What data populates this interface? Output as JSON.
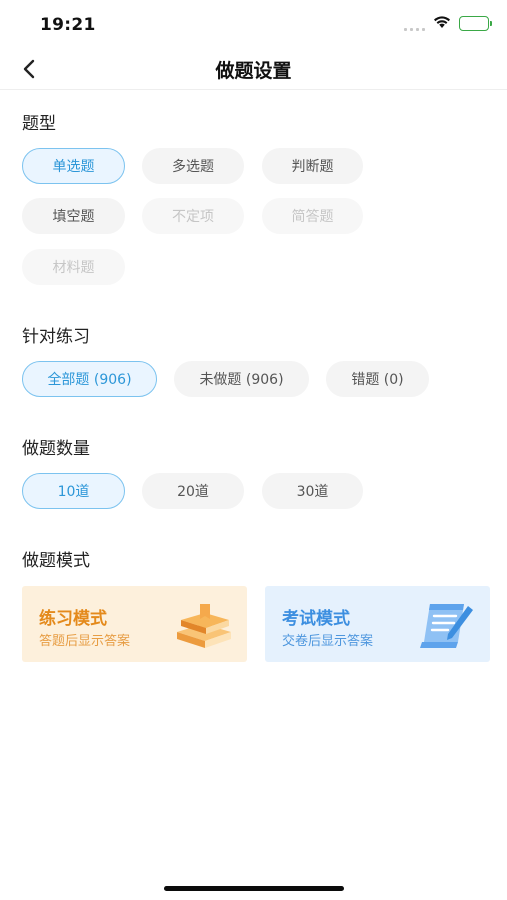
{
  "status_bar": {
    "time": "19:21"
  },
  "nav": {
    "title": "做题设置"
  },
  "question_type": {
    "title": "题型",
    "options": [
      {
        "label": "单选题",
        "state": "selected"
      },
      {
        "label": "多选题",
        "state": "normal"
      },
      {
        "label": "判断题",
        "state": "normal"
      },
      {
        "label": "填空题",
        "state": "normal"
      },
      {
        "label": "不定项",
        "state": "disabled"
      },
      {
        "label": "简答题",
        "state": "disabled"
      },
      {
        "label": "材料题",
        "state": "disabled"
      }
    ]
  },
  "target_practice": {
    "title": "针对练习",
    "options": [
      {
        "label": "全部题 (906)",
        "state": "selected"
      },
      {
        "label": "未做题 (906)",
        "state": "normal"
      },
      {
        "label": "错题 (0)",
        "state": "normal"
      }
    ]
  },
  "question_count": {
    "title": "做题数量",
    "options": [
      {
        "label": "10道",
        "state": "selected"
      },
      {
        "label": "20道",
        "state": "normal"
      },
      {
        "label": "30道",
        "state": "normal"
      }
    ]
  },
  "practice_mode": {
    "title": "做题模式",
    "cards": [
      {
        "title": "练习模式",
        "desc": "答题后显示答案",
        "icon": "books-icon"
      },
      {
        "title": "考试模式",
        "desc": "交卷后显示答案",
        "icon": "scroll-pen-icon"
      }
    ]
  },
  "colors": {
    "accent": "#2d97d8",
    "selected_border": "#7cc3ef",
    "practice_card_bg": "#fdf0dc",
    "practice_accent": "#e48a1c",
    "exam_card_bg": "#e5f1fd",
    "exam_accent": "#3d8fe0"
  }
}
